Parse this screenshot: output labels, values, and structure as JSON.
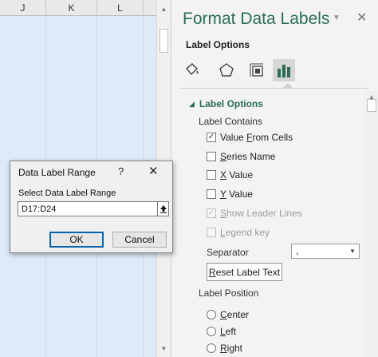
{
  "sheet": {
    "columns": [
      "J",
      "K",
      "L"
    ]
  },
  "pane": {
    "title": "Format Data Labels",
    "subtitle": "Label Options",
    "category_icons": [
      "fill-line-icon",
      "effects-pentagon-icon",
      "size-properties-icon",
      "label-options-bar-chart-icon"
    ],
    "section": "Label Options",
    "contains_label": "Label Contains",
    "options": [
      {
        "pre": "Value ",
        "key": "F",
        "post": "rom Cells",
        "checked": true,
        "disabled": false
      },
      {
        "pre": "",
        "key": "S",
        "post": "eries Name",
        "checked": false,
        "disabled": false
      },
      {
        "pre": "",
        "key": "X",
        "post": " Value",
        "checked": false,
        "disabled": false
      },
      {
        "pre": "",
        "key": "Y",
        "post": " Value",
        "checked": false,
        "disabled": false
      },
      {
        "pre": "",
        "key": "S",
        "post": "how Leader Lines",
        "checked": true,
        "disabled": true
      },
      {
        "pre": "",
        "key": "L",
        "post": "egend key",
        "checked": false,
        "disabled": true
      }
    ],
    "separator_label": "Separator",
    "separator_value": ",",
    "reset_button": {
      "key": "R",
      "post": "eset Label Text"
    },
    "position_label": "Label Position",
    "positions": [
      {
        "key": "C",
        "post": "enter"
      },
      {
        "key": "L",
        "post": "eft"
      },
      {
        "key": "R",
        "post": "ight"
      }
    ],
    "accent_color": "#2a6f53"
  },
  "dialog": {
    "title": "Data Label Range",
    "help": "?",
    "close": "✕",
    "field_label": "Select Data Label Range",
    "field_value": "D17:D24",
    "ok": "OK",
    "cancel": "Cancel"
  }
}
